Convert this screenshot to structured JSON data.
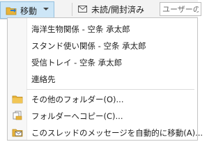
{
  "toolbar": {
    "move_label": "移動",
    "unread_label": "未読/開封済み",
    "search_placeholder": "ユーザーの検"
  },
  "menu": {
    "recent_folders": [
      {
        "label": "海洋生物関係 - 空条 承太郎"
      },
      {
        "label": "スタンド使い関係 - 空条 承太郎"
      },
      {
        "label": "受信トレイ - 空条 承太郎"
      },
      {
        "label": "連絡先"
      }
    ],
    "actions": [
      {
        "label": "その他のフォルダー(O)...",
        "icon": "folder-icon"
      },
      {
        "label": "フォルダーへコピー(C)...",
        "icon": "copy-to-folder-icon"
      },
      {
        "label": "このスレッドのメッセージを自動的に移動(A)...",
        "icon": "auto-move-thread-icon"
      }
    ]
  },
  "colors": {
    "move_button_bg": "#cde6f7",
    "move_button_border": "#94c0e0",
    "folder_yellow": "#e8b33a",
    "envelope_stroke": "#555555"
  }
}
